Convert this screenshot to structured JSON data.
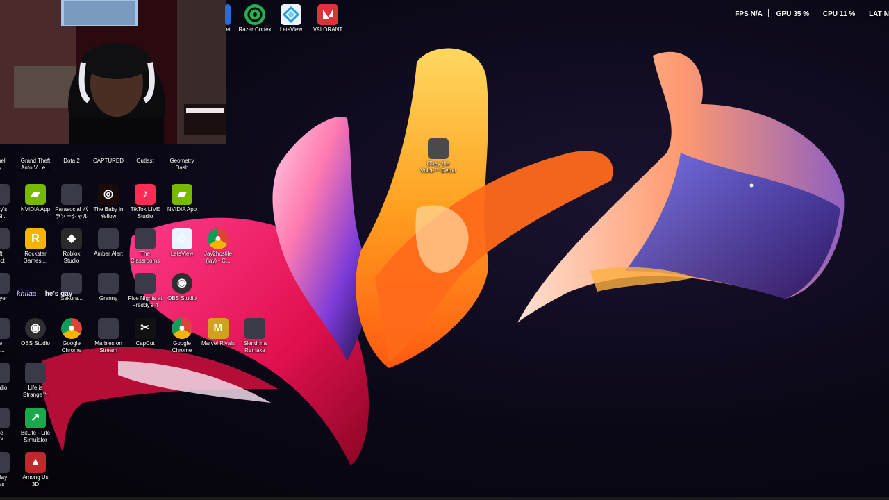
{
  "performance_overlay": {
    "fps": {
      "label": "FPS",
      "value": "N/A"
    },
    "gpu": {
      "label": "GPU",
      "value": "35 %"
    },
    "cpu": {
      "label": "CPU",
      "value": "11 %"
    },
    "lat": {
      "label": "LAT",
      "value": "N"
    }
  },
  "chat_overlay": {
    "username": "khiiaa_",
    "message": "he's gay"
  },
  "top_icons": [
    {
      "label": "et",
      "color": "#2a6cd6",
      "icon": "app-icon"
    },
    {
      "label": "Razer Cortex",
      "color": "#22b14c",
      "icon": "razer-cortex-icon"
    },
    {
      "label": "LetsView",
      "color": "#e9f4ff",
      "icon": "letsview-icon"
    },
    {
      "label": "VALORANT",
      "color": "#e0323c",
      "icon": "valorant-icon"
    }
  ],
  "desktop_icons": {
    "row1": [
      "amel\nty",
      "Grand Theft\nAuto V Le...",
      "Dota 2",
      "CAPTURED",
      "Outlast",
      "Geometry\nDash"
    ],
    "row2": [
      "ancy's\nw Si...",
      "NVIDIA App",
      "Parasocial パ\nラソーシャル",
      "The Baby in\nYellow",
      "TikTok LIVE\nStudio",
      "NVIDIA App"
    ],
    "row3": [
      "oft\nnect",
      "Rockstar\nGames ...",
      "Roblox\nStudio",
      "Amber Alert",
      "The\nClassrooms",
      "LetsView",
      "Jay2hostile\n(jay) - C..."
    ],
    "row4": [
      "Player",
      "Sakura...",
      "Granny",
      "Five Nights at\nFreddy's 4",
      "OBS Studio"
    ],
    "row5": [
      "ce\nlat...",
      "OBS Studio",
      "Google\nChrome",
      "Marbles on\nStream",
      "CapCut",
      "Google\nChrome",
      "Marvel Rivals",
      "Slendrina\nRemake"
    ],
    "row6": [
      "Studio",
      "Life is\nStrange™"
    ],
    "row7": [
      "the\ne™",
      "BitLife - Life\nSimulator"
    ],
    "row8": [
      "e Play\nmes",
      "Among Us\n3D"
    ]
  },
  "floating_icon": {
    "label": "Obey the\nVoice™ Demo"
  },
  "colors": {
    "background": "#07050f",
    "nvidia_green": "#76b900",
    "chrome_red": "#db4437",
    "chrome_yellow": "#f4b400",
    "chrome_green": "#0f9d58",
    "obs_dark": "#302e31"
  }
}
